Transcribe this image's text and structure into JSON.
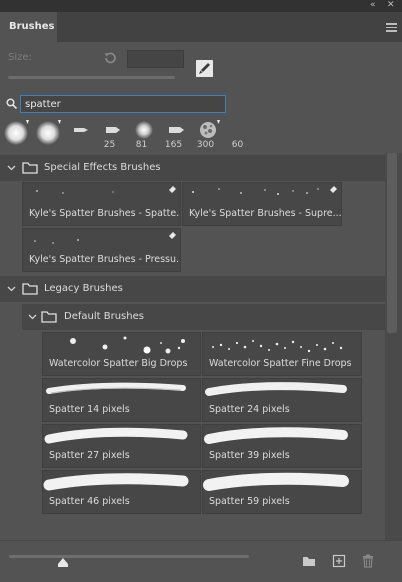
{
  "window": {
    "collapse_glyph": "«",
    "close_glyph": "✕"
  },
  "panel": {
    "tab_label": "Brushes"
  },
  "size": {
    "label": "Size:",
    "value": ""
  },
  "search": {
    "value": "spatter"
  },
  "recent_brushes": [
    {
      "size": "",
      "icon": "round-brush-icon"
    },
    {
      "size": "",
      "icon": "round-brush-icon"
    },
    {
      "size": "25",
      "icon": "brush-tip-icon"
    },
    {
      "size": "81",
      "icon": "brush-tip-icon"
    },
    {
      "size": "165",
      "icon": "soft-round-icon"
    },
    {
      "size": "300",
      "icon": "brush-tip-icon"
    },
    {
      "size": "60",
      "icon": "texture-brush-icon"
    }
  ],
  "groups": {
    "special_effects": {
      "label": "Special Effects Brushes",
      "brushes": [
        "Kyle's Spatter Brushes - Spatte...",
        "Kyle's Spatter Brushes - Supre...",
        "Kyle's Spatter Brushes - Pressu..."
      ]
    },
    "legacy": {
      "label": "Legacy Brushes"
    },
    "default": {
      "label": "Default Brushes",
      "brushes": [
        "Watercolor Spatter Big Drops",
        "Watercolor Spatter Fine Drops",
        "Spatter 14 pixels",
        "Spatter 24 pixels",
        "Spatter 27 pixels",
        "Spatter 39 pixels",
        "Spatter 46 pixels",
        "Spatter 59 pixels"
      ]
    }
  },
  "colors": {
    "panel_bg": "#535353",
    "header_bg": "#474747",
    "search_focus": "#3f7fbf",
    "text": "#d6d6d6"
  }
}
